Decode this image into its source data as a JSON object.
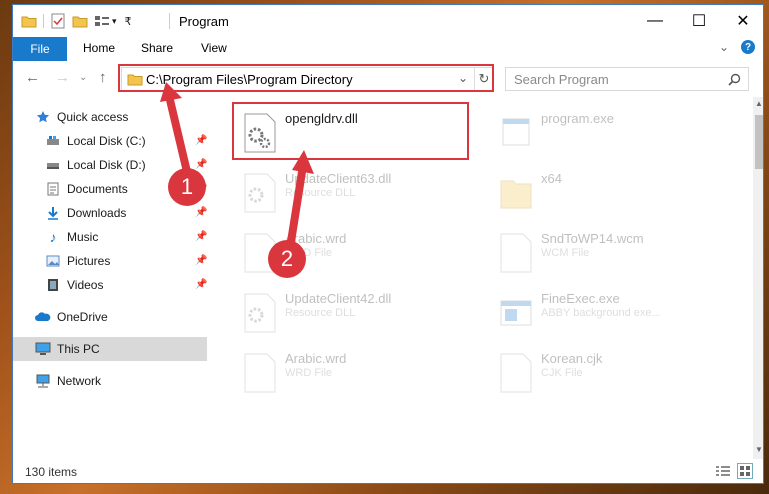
{
  "window": {
    "title": "Program",
    "minimize": "—",
    "maximize": "☐",
    "close": "✕"
  },
  "ribbon": {
    "tabs": [
      "File",
      "Home",
      "Share",
      "View"
    ],
    "help": "?"
  },
  "address": {
    "path": "C:\\Program Files\\Program Directory",
    "search_placeholder": "Search Program"
  },
  "nav": {
    "items": [
      {
        "label": "Quick access",
        "icon": "star-icon",
        "pinned": false
      },
      {
        "label": "Local Disk (C:)",
        "icon": "drive-icon",
        "pinned": true
      },
      {
        "label": "Local Disk (D:)",
        "icon": "drive-icon",
        "pinned": true
      },
      {
        "label": "Documents",
        "icon": "document-icon",
        "pinned": true
      },
      {
        "label": "Downloads",
        "icon": "download-icon",
        "pinned": true
      },
      {
        "label": "Music",
        "icon": "music-icon",
        "pinned": true
      },
      {
        "label": "Pictures",
        "icon": "pictures-icon",
        "pinned": true
      },
      {
        "label": "Videos",
        "icon": "videos-icon",
        "pinned": true
      },
      {
        "label": "OneDrive",
        "icon": "cloud-icon",
        "pinned": false
      },
      {
        "label": "This PC",
        "icon": "computer-icon",
        "pinned": false
      },
      {
        "label": "Network",
        "icon": "network-icon",
        "pinned": false
      }
    ]
  },
  "files": [
    {
      "name": "opengldrv.dll",
      "type": "",
      "icon": "dll-icon"
    },
    {
      "name": "program.exe",
      "type": "",
      "icon": "exe-icon"
    },
    {
      "name": "UpdateClient63.dll",
      "type": "Resource DLL",
      "icon": "dll-icon"
    },
    {
      "name": "x64",
      "type": "",
      "icon": "folder-icon"
    },
    {
      "name": "Arabic.wrd",
      "type": "WRD File",
      "icon": "file-icon"
    },
    {
      "name": "SndToWP14.wcm",
      "type": "WCM File",
      "icon": "file-icon"
    },
    {
      "name": "UpdateClient42.dll",
      "type": "Resource DLL",
      "icon": "dll-icon"
    },
    {
      "name": "FineExec.exe",
      "type": "ABBY background exe...",
      "icon": "exe-icon"
    },
    {
      "name": "Arabic.wrd",
      "type": "WRD File",
      "icon": "file-icon"
    },
    {
      "name": "Korean.cjk",
      "type": "CJK File",
      "icon": "file-icon"
    }
  ],
  "status": {
    "count": "130 items"
  },
  "annotations": {
    "step1": "1",
    "step2": "2",
    "color": "#d9373d"
  }
}
